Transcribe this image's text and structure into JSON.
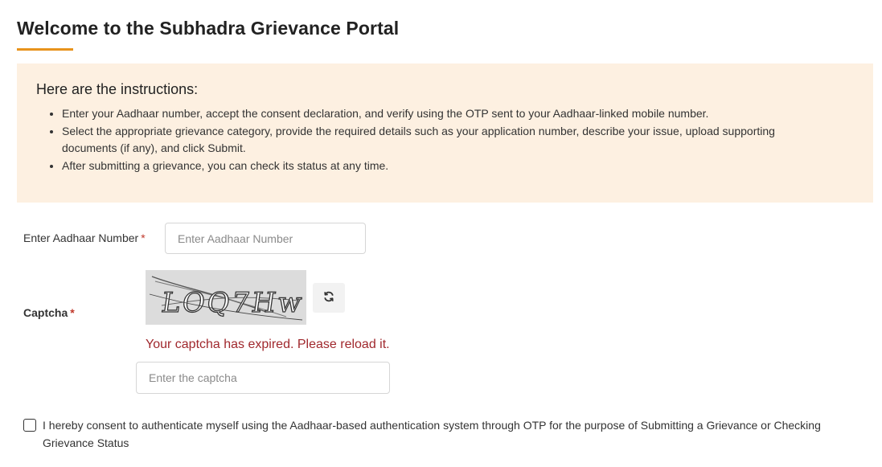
{
  "header": {
    "title": "Welcome to the Subhadra Grievance Portal"
  },
  "instructions": {
    "heading": "Here are the instructions:",
    "items": [
      "Enter your Aadhaar number, accept the consent declaration, and verify using the OTP sent to your Aadhaar-linked mobile number.",
      "Select the appropriate grievance category, provide the required details such as your application number, describe your issue, upload supporting documents (if any), and click Submit.",
      "After submitting a grievance, you can check its status at any time."
    ]
  },
  "form": {
    "aadhaar_label": "Enter Aadhaar Number",
    "aadhaar_placeholder": "Enter Aadhaar Number",
    "aadhaar_value": "",
    "captcha_label": "Captcha",
    "captcha_image_text": "LOQ7Hw",
    "refresh_icon": "refresh-icon",
    "captcha_error": "Your captcha has expired. Please reload it.",
    "captcha_placeholder": "Enter the captcha",
    "captcha_value": "",
    "required_marker": "*",
    "consent_text": "I hereby consent to authenticate myself using the Aadhaar-based authentication system through OTP for the purpose of Submitting a Grievance or Checking Grievance Status",
    "consent_checked": false
  },
  "colors": {
    "accent": "#e8931c",
    "instructions_background": "#fdf0e1",
    "error": "#a0282d",
    "required": "#c0392b"
  }
}
